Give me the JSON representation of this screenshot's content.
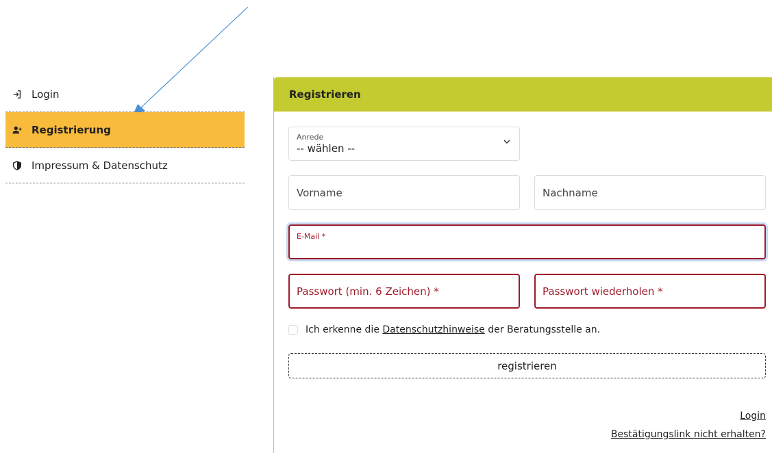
{
  "sidebar": {
    "items": [
      {
        "label": "Login",
        "icon": "login-icon",
        "active": false
      },
      {
        "label": "Registrierung",
        "icon": "user-plus-icon",
        "active": true
      },
      {
        "label": "Impressum & Datenschutz",
        "icon": "shield-icon",
        "active": false
      }
    ]
  },
  "panel": {
    "title": "Registrieren",
    "anrede": {
      "label": "Anrede",
      "value": "-- wählen --"
    },
    "vorname": {
      "placeholder": "Vorname"
    },
    "nachname": {
      "placeholder": "Nachname"
    },
    "email": {
      "label": "E-Mail *"
    },
    "passwort": {
      "placeholder": "Passwort (min. 6 Zeichen) *"
    },
    "passwort_repeat": {
      "placeholder": "Passwort wiederholen *"
    },
    "consent": {
      "prefix": "Ich erkenne die ",
      "link": "Datenschutzhinweise",
      "suffix": " der Beratungsstelle an."
    },
    "submit_label": "registrieren",
    "links": {
      "login": "Login",
      "confirm": "Bestätigungslink nicht erhalten?"
    }
  },
  "colors": {
    "active_item": "#f8bb3c",
    "header": "#c3cb30",
    "error": "#9e1b2a",
    "arrow": "#4a90d9"
  }
}
